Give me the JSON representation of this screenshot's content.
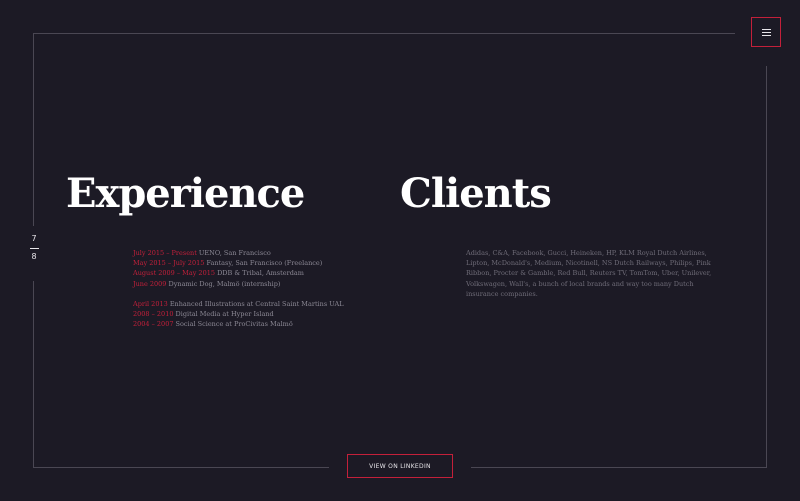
{
  "pager": {
    "current": "7",
    "total": "8"
  },
  "experience": {
    "title": "Experience",
    "work": [
      {
        "date": "July 2015 – Present",
        "text": "UENO, San Francisco"
      },
      {
        "date": "May 2015 – July 2015",
        "text": "Fantasy, San Francisco (Freelance)"
      },
      {
        "date": "August 2009 – May 2015",
        "text": "DDB & Tribal, Amsterdam"
      },
      {
        "date": "June 2009",
        "text": "Dynamic Dog, Malmö (internship)"
      }
    ],
    "education": [
      {
        "date": "April 2013",
        "text": "Enhanced Illustrations at Central Saint Martins UAL"
      },
      {
        "date": "2008 – 2010",
        "text": "Digital Media at Hyper Island"
      },
      {
        "date": "2004 – 2007",
        "text": "Social Science at ProCivitas Malmö"
      }
    ]
  },
  "clients": {
    "title": "Clients",
    "text": "Adidas, C&A, Facebook, Gucci, Heineken, HP, KLM Royal Dutch Airlines, Lipton, McDonald's, Medium, Nicotinell, NS Dutch Railways, Philips, Pink Ribbon, Procter & Gamble, Red Bull, Reuters TV, TomTom, Uber, Unilever, Volkswagen, Wall's, a bunch of local brands and way too many Dutch insurance companies."
  },
  "linkedin_button": "VIEW ON LINKEDIN",
  "menu": {
    "icon": "hamburger-menu-icon"
  },
  "colors": {
    "background": "#1c1a25",
    "accent": "#c3203a",
    "heading": "#ffffff",
    "body_text": "#8c8995"
  }
}
